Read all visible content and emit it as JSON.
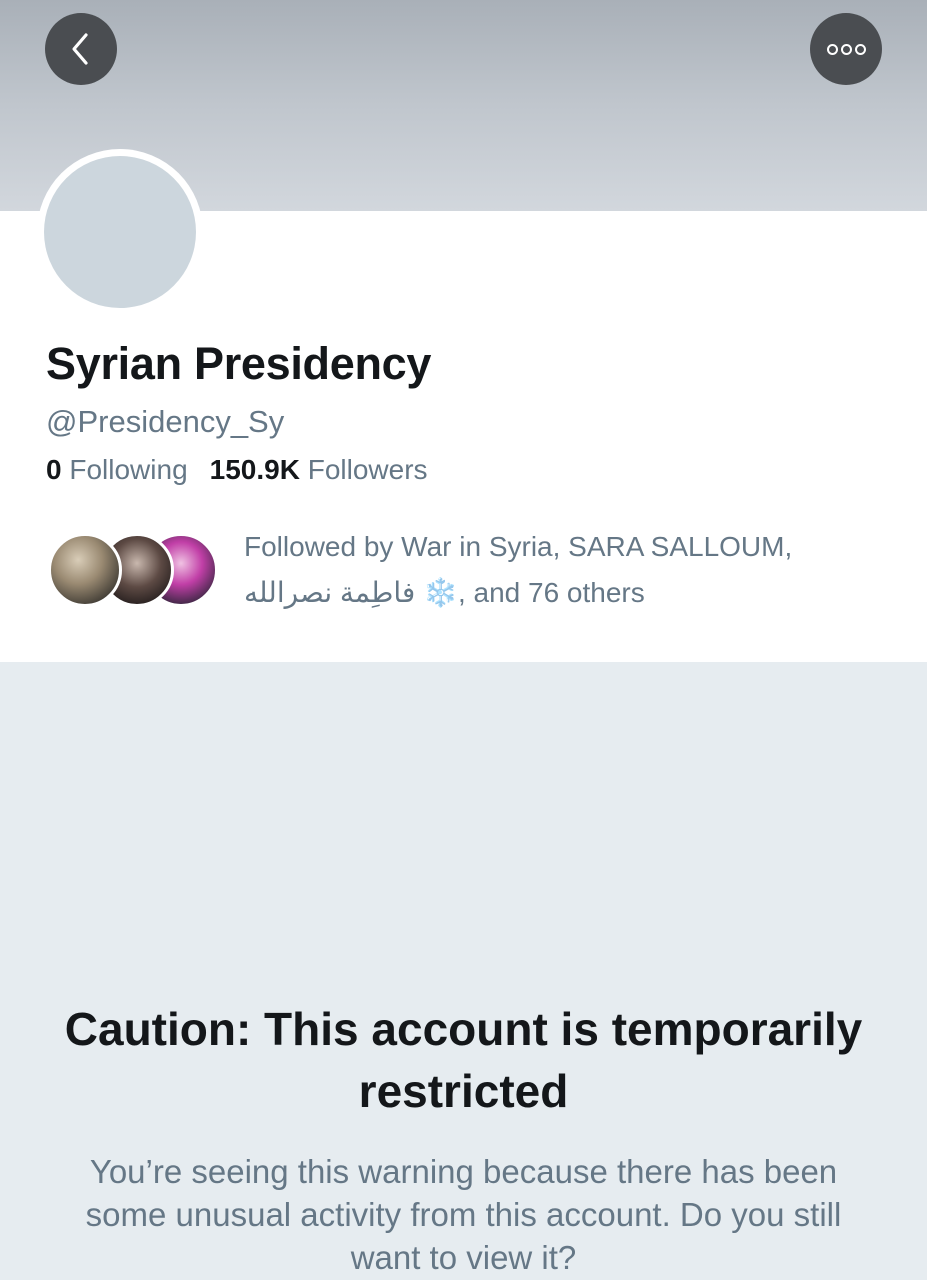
{
  "header": {
    "back_icon": "chevron-left-icon",
    "more_icon": "more-options-icon"
  },
  "profile": {
    "display_name": "Syrian Presidency",
    "handle": "@Presidency_Sy",
    "following_count": "0",
    "following_label": "Following",
    "followers_count": "150.9K",
    "followers_label": "Followers"
  },
  "followed_by": {
    "line1": "Followed by War in Syria, SARA SALLOUM,",
    "name_arabic": "فاطِمة نصرالله",
    "emoji": "❄️",
    "line2_suffix": ", and 76 others"
  },
  "restriction": {
    "title": "Caution: This account is temporarily restricted",
    "body": "You’re seeing this warning because there has been some unusual activity from this account. Do you still want to view it?"
  },
  "colors": {
    "primary_text": "#14171a",
    "secondary_text": "#657786",
    "background": "#e6ecf0",
    "nav_button": "#4a4d51"
  }
}
